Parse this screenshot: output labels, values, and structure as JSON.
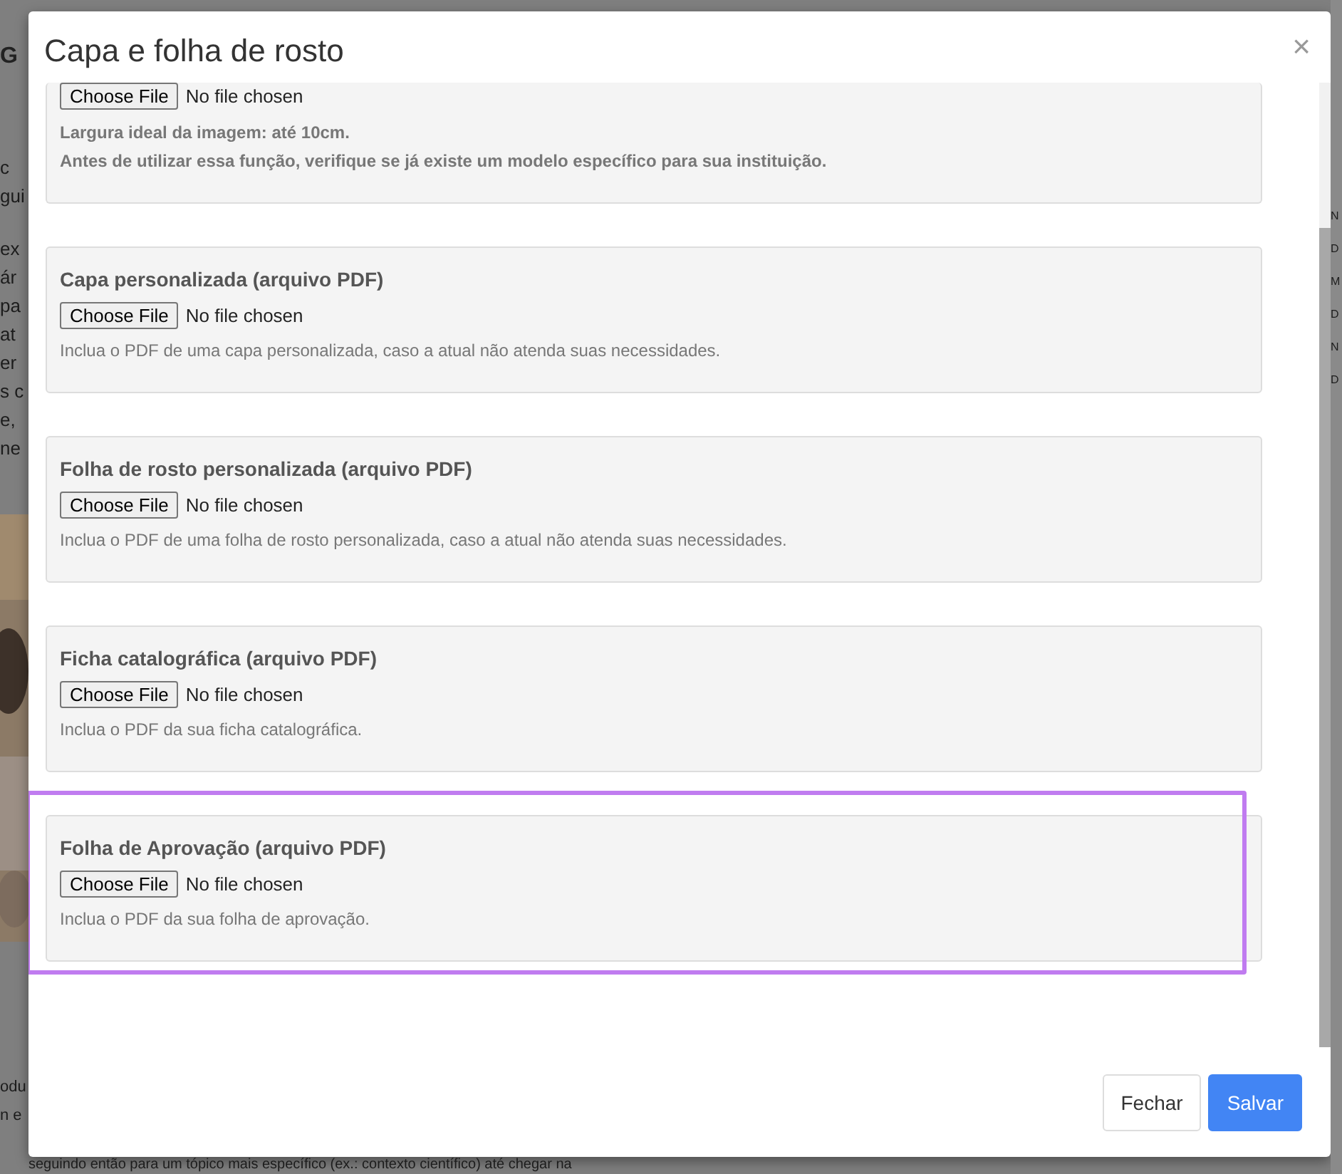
{
  "background": {
    "heading_fragment": "G",
    "left_paragraphs": [
      [
        "c",
        "gui"
      ],
      [
        "ex",
        "ár",
        "pa",
        "at",
        "er",
        "s c",
        "e,",
        "ne"
      ],
      [
        "odu",
        "n e"
      ]
    ],
    "bottom_line": "seguindo então para um tópico mais específico (ex.: contexto científico) até chegar na",
    "right_fragments": [
      "N",
      "D",
      "M",
      "D",
      "N",
      "D"
    ]
  },
  "modal": {
    "title": "Capa e folha de rosto",
    "close": "×",
    "cards": [
      {
        "kind": "notes",
        "file_button": "Choose File",
        "file_status": "No file chosen",
        "notes": [
          "Largura ideal da imagem: até 10cm.",
          "Antes de utilizar essa função, verifique se já existe um modelo específico para sua instituição."
        ],
        "highlighted": false
      },
      {
        "kind": "upload",
        "title": "Capa personalizada (arquivo PDF)",
        "file_button": "Choose File",
        "file_status": "No file chosen",
        "help": "Inclua o PDF de uma capa personalizada, caso a atual não atenda suas necessidades.",
        "highlighted": false
      },
      {
        "kind": "upload",
        "title": "Folha de rosto personalizada (arquivo PDF)",
        "file_button": "Choose File",
        "file_status": "No file chosen",
        "help": "Inclua o PDF de uma folha de rosto personalizada, caso a atual não atenda suas necessidades.",
        "highlighted": false
      },
      {
        "kind": "upload",
        "title": "Ficha catalográfica (arquivo PDF)",
        "file_button": "Choose File",
        "file_status": "No file chosen",
        "help": "Inclua o PDF da sua ficha catalográfica.",
        "highlighted": false
      },
      {
        "kind": "upload",
        "title": "Folha de Aprovação (arquivo PDF)",
        "file_button": "Choose File",
        "file_status": "No file chosen",
        "help": "Inclua o PDF da sua folha de aprovação.",
        "highlighted": true
      }
    ],
    "buttons": [
      {
        "label": "Fechar",
        "kind": "secondary"
      },
      {
        "label": "Salvar",
        "kind": "primary"
      }
    ]
  }
}
